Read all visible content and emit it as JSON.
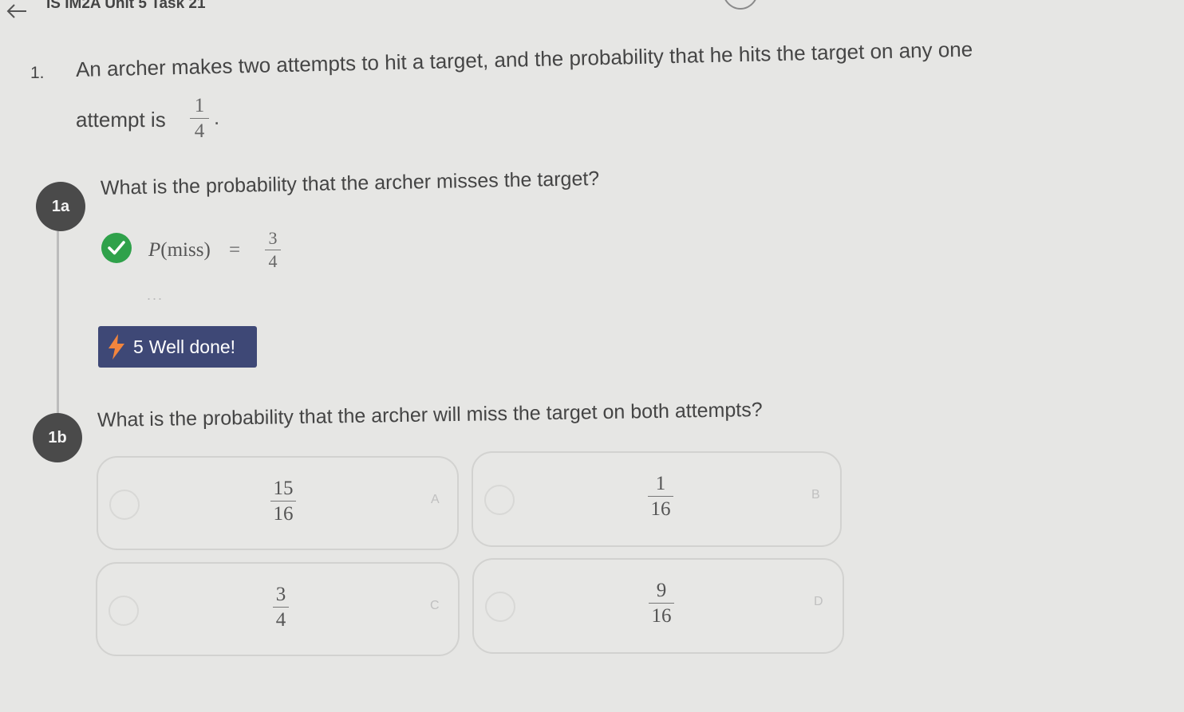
{
  "header": {
    "title": "IS IM2A Unit 5 Task 21",
    "back_icon": "arrow-left-icon"
  },
  "problem": {
    "number": "1.",
    "stem_line1": "An archer makes two attempts to hit a target, and the probability that he hits the target on any one",
    "stem_line2": "attempt is",
    "hit_prob": {
      "num": "1",
      "den": "4"
    },
    "period": "."
  },
  "step_1a": {
    "badge": "1a",
    "prompt": "What is the probability that the archer misses the target?",
    "answer_expr": "P(miss)",
    "answer_eq": "=",
    "answer_value": {
      "num": "3",
      "den": "4"
    },
    "status_icon": "check-circle-icon",
    "status_color": "#2fa14a",
    "more": "...",
    "reward": {
      "points": "5",
      "message": "Well done!",
      "icon": "lightning-bolt-icon",
      "color": "#3e4876"
    }
  },
  "step_1b": {
    "badge": "1b",
    "prompt": "What is the probability that the archer will miss the target on both attempts?",
    "options": [
      {
        "letter": "A",
        "num": "15",
        "den": "16"
      },
      {
        "letter": "B",
        "num": "1",
        "den": "16"
      },
      {
        "letter": "C",
        "num": "3",
        "den": "4"
      },
      {
        "letter": "D",
        "num": "9",
        "den": "16"
      }
    ]
  }
}
